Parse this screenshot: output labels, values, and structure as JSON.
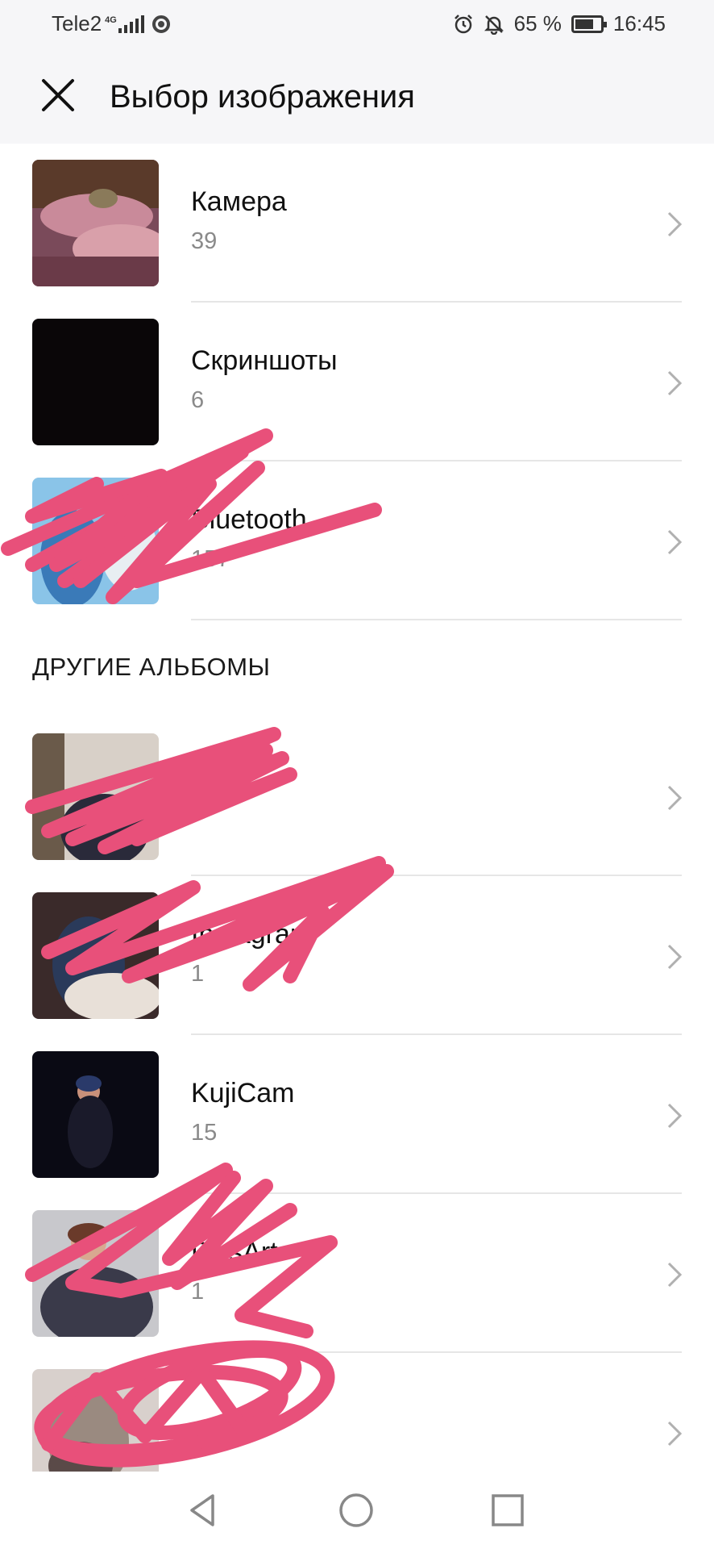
{
  "status_bar": {
    "carrier": "Tele2",
    "network": "4G",
    "battery_percent": "65 %",
    "time": "16:45",
    "icons": [
      "signal-icon",
      "chrome-icon",
      "alarm-icon",
      "bell-off-icon",
      "battery-icon"
    ]
  },
  "header": {
    "title": "Выбор изображения",
    "close_icon": "close-icon"
  },
  "albums": [
    {
      "name": "Камера",
      "count": "39",
      "thumb_colors": [
        "#7a4a5a",
        "#c98a9a",
        "#5a3a2a"
      ]
    },
    {
      "name": "Скриншоты",
      "count": "6",
      "thumb_colors": [
        "#0a0608",
        "#120a0c",
        "#080506"
      ]
    },
    {
      "name": "Bluetooth",
      "count": "157",
      "thumb_colors": [
        "#3a7ab8",
        "#8ac4e8",
        "#e8eef2"
      ]
    }
  ],
  "other_albums": {
    "section_title": "ДРУГИЕ АЛЬБОМЫ",
    "items": [
      {
        "name": "",
        "count": "",
        "thumb_colors": [
          "#6a5a4a",
          "#d8d0c8",
          "#2a2a3a"
        ]
      },
      {
        "name": "Instagram",
        "count": "1",
        "thumb_colors": [
          "#3a2a2a",
          "#e8e0d8",
          "#2a3a5a"
        ]
      },
      {
        "name": "KujiCam",
        "count": "15",
        "thumb_colors": [
          "#0a0a14",
          "#1a1a2a",
          "#0a0a12"
        ]
      },
      {
        "name": "PicsArt",
        "count": "1",
        "thumb_colors": [
          "#c8c8cc",
          "#3a3a4a",
          "#8a7a78"
        ]
      },
      {
        "name": "",
        "count": "",
        "thumb_colors": [
          "#9a8a80",
          "#d8d0cc",
          "#5a4a48"
        ]
      }
    ]
  },
  "nav_bar": {
    "back_icon": "back-triangle-icon",
    "home_icon": "home-circle-icon",
    "recents_icon": "recents-square-icon"
  },
  "colors": {
    "header_bg": "#f6f6f8",
    "scribble": "#e8507a",
    "divider": "#e6e6e6",
    "secondary_text": "#8a8a8a"
  }
}
